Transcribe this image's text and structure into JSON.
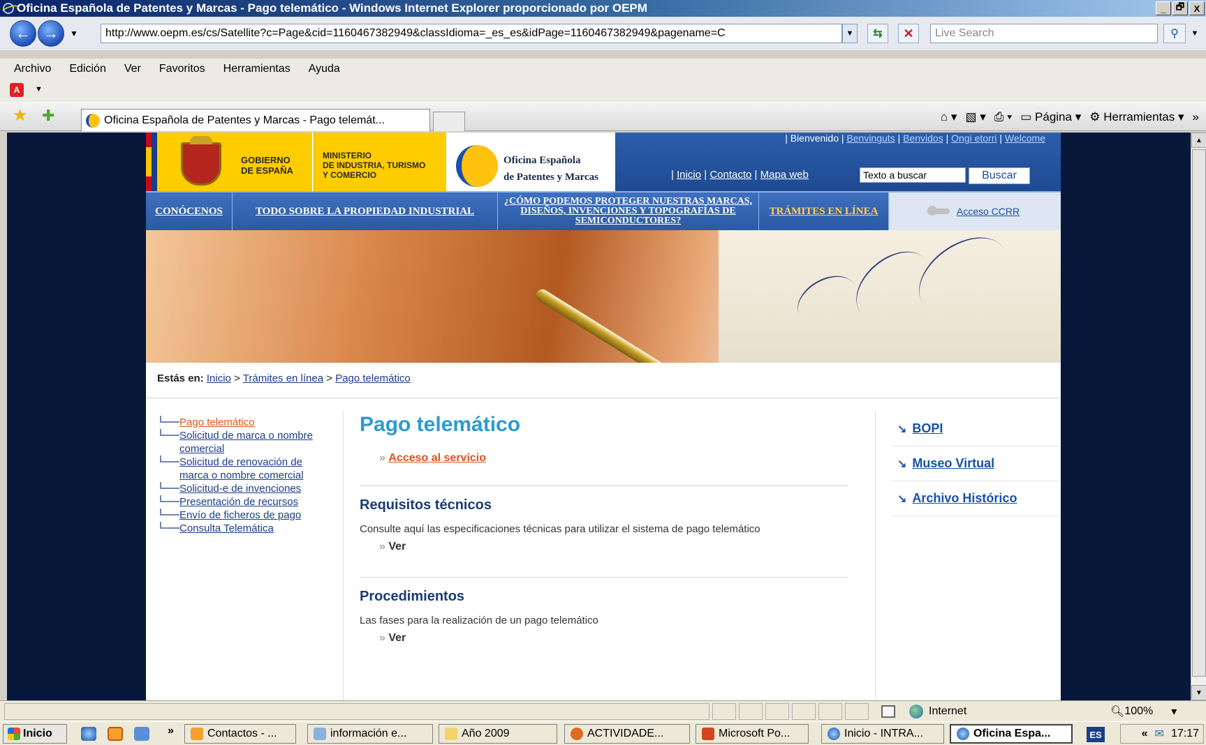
{
  "window": {
    "title": "Oficina Española de Patentes y Marcas - Pago telemático - Windows Internet Explorer proporcionado por OEPM",
    "min_label": "_",
    "max_label": "🗗",
    "close_label": "X"
  },
  "toolbar": {
    "address": "http://www.oepm.es/cs/Satellite?c=Page&cid=1160467382949&classIdioma=_es_es&idPage=1160467382949&pagename=C",
    "search_placeholder": "Live Search"
  },
  "menu": [
    "Archivo",
    "Edición",
    "Ver",
    "Favoritos",
    "Herramientas",
    "Ayuda"
  ],
  "tab": {
    "label": "Oficina Española de Patentes y Marcas - Pago telemát..."
  },
  "command_bar": {
    "page_label": "Página",
    "tools_label": "Herramientas",
    "more": "»"
  },
  "site": {
    "gob_line1": "GOBIERNO",
    "gob_line2": "DE ESPAÑA",
    "min_line1": "MINISTERIO",
    "min_line2": "DE INDUSTRIA, TURISMO",
    "min_line3": "Y COMERCIO",
    "oepm_line1": "Oficina Española",
    "oepm_line2": "de Patentes y Marcas",
    "welcome": "| Bienvenido |",
    "lang_links": [
      "Benvinguts",
      "Benvidos",
      "Ongi etorri",
      "Welcome"
    ],
    "util_links": [
      "Inicio",
      "Contacto",
      "Mapa web"
    ],
    "search_value": "Texto a buscar",
    "search_button": "Buscar",
    "nav": {
      "conocenos": "CONÓCENOS",
      "todo": "TODO SOBRE LA PROPIEDAD INDUSTRIAL",
      "como": "¿CÓMO PODEMOS PROTEGER NUESTRAS MARCAS, DISEÑOS, INVENCIONES Y TOPOGRAFÍAS DE SEMICONDUCTORES?",
      "tramites": "TRÁMITES EN LÍNEA",
      "ccrr": "Acceso CCRR"
    },
    "breadcrumb": {
      "prefix": "Estás en:",
      "items": [
        "Inicio",
        "Trámites en línea",
        "Pago telemático"
      ],
      "sep": ">"
    },
    "left_nav": [
      "Pago telemático",
      "Solicitud de marca o nombre comercial",
      "Solicitud de renovación de marca o nombre comercial",
      "Solicitud-e de invenciones",
      "Presentación de recursos",
      "Envío de ficheros de pago",
      "Consulta Telemática"
    ],
    "main": {
      "title": "Pago telemático",
      "access_link": "Acceso al servicio",
      "arrow": "»",
      "req_title": "Requisitos técnicos",
      "req_desc": "Consulte aquí las especificaciones técnicas para utilizar el sistema de pago telemático",
      "ver": "Ver",
      "proc_title": "Procedimientos",
      "proc_desc": "Las fases para la realización de un pago telemático"
    },
    "right_links": [
      "BOPI",
      "Museo Virtual",
      "Archivo Histórico"
    ]
  },
  "status": {
    "zone": "Internet",
    "zoom": "100%"
  },
  "taskbar": {
    "start": "Inicio",
    "more": "»",
    "buttons": [
      "Contactos - ...",
      "información e...",
      "Año 2009",
      "ACTIVIDADE...",
      "Microsoft Po...",
      "Inicio - INTRA...",
      "Oficina Espa..."
    ],
    "lang": "ES",
    "clock": "17:17"
  }
}
